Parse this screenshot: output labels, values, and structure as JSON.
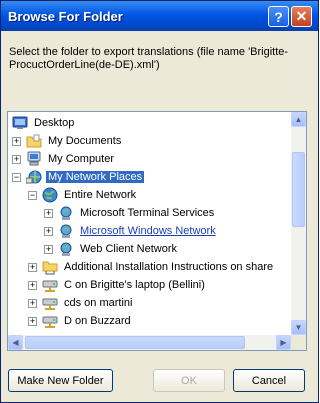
{
  "window": {
    "title": "Browse For Folder",
    "help_glyph": "?",
    "close_glyph": "✕"
  },
  "prompt": "Select the folder to export translations (file name 'Brigitte-ProcuctOrderLine(de-DE).xml')",
  "tree": [
    {
      "label": "Desktop",
      "icon": "desktop-icon",
      "level": 0,
      "expander": "",
      "selected": false,
      "link": false
    },
    {
      "label": "My Documents",
      "icon": "folder-icon",
      "level": 1,
      "expander": "+",
      "selected": false,
      "link": false
    },
    {
      "label": "My Computer",
      "icon": "computer-icon",
      "level": 1,
      "expander": "+",
      "selected": false,
      "link": false
    },
    {
      "label": "My Network Places",
      "icon": "network-places-icon",
      "level": 1,
      "expander": "−",
      "selected": true,
      "link": false
    },
    {
      "label": "Entire Network",
      "icon": "globe-icon",
      "level": 2,
      "expander": "−",
      "selected": false,
      "link": false
    },
    {
      "label": "Microsoft Terminal Services",
      "icon": "network-provider-icon",
      "level": 3,
      "expander": "+",
      "selected": false,
      "link": false
    },
    {
      "label": "Microsoft Windows Network",
      "icon": "network-provider-icon",
      "level": 3,
      "expander": "+",
      "selected": false,
      "link": true
    },
    {
      "label": "Web Client Network",
      "icon": "network-provider-icon",
      "level": 3,
      "expander": "+",
      "selected": false,
      "link": false
    },
    {
      "label": "Additional Installation Instructions on share",
      "icon": "network-folder-icon",
      "level": 2,
      "expander": "+",
      "selected": false,
      "link": false
    },
    {
      "label": "C on Brigitte's laptop (Bellini)",
      "icon": "network-drive-icon",
      "level": 2,
      "expander": "+",
      "selected": false,
      "link": false
    },
    {
      "label": "cds on martini",
      "icon": "network-drive-icon",
      "level": 2,
      "expander": "+",
      "selected": false,
      "link": false
    },
    {
      "label": "D on Buzzard",
      "icon": "network-drive-icon",
      "level": 2,
      "expander": "+",
      "selected": false,
      "link": false
    }
  ],
  "scroll": {
    "up": "▲",
    "down": "▼",
    "left": "◀",
    "right": "▶"
  },
  "buttons": {
    "new_folder": "Make New Folder",
    "ok": "OK",
    "cancel": "Cancel"
  }
}
